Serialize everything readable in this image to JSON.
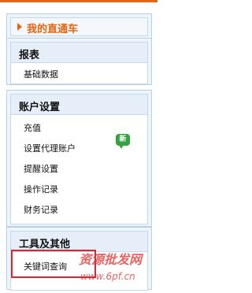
{
  "nav": {
    "section_main": {
      "label": "我的直通车"
    },
    "section_reports": {
      "title": "报表",
      "items": [
        {
          "label": "基础数据"
        }
      ]
    },
    "section_account": {
      "title": "账户设置",
      "items": [
        {
          "label": "充值"
        },
        {
          "label": "设置代理账户",
          "badge": "新"
        },
        {
          "label": "提醒设置"
        },
        {
          "label": "操作记录"
        },
        {
          "label": "财务记录"
        }
      ]
    },
    "section_tools": {
      "title": "工具及其他",
      "items": [
        {
          "label": "关键词查询"
        }
      ]
    }
  },
  "watermark": {
    "text": "资源批发网",
    "url": "www.6pf.cn"
  },
  "colors": {
    "accent": "#e8650f",
    "panel_border": "#b9cfe6",
    "header_bg": "#e6eff9",
    "badge_bg": "#33a341",
    "highlight": "#e0242c"
  }
}
